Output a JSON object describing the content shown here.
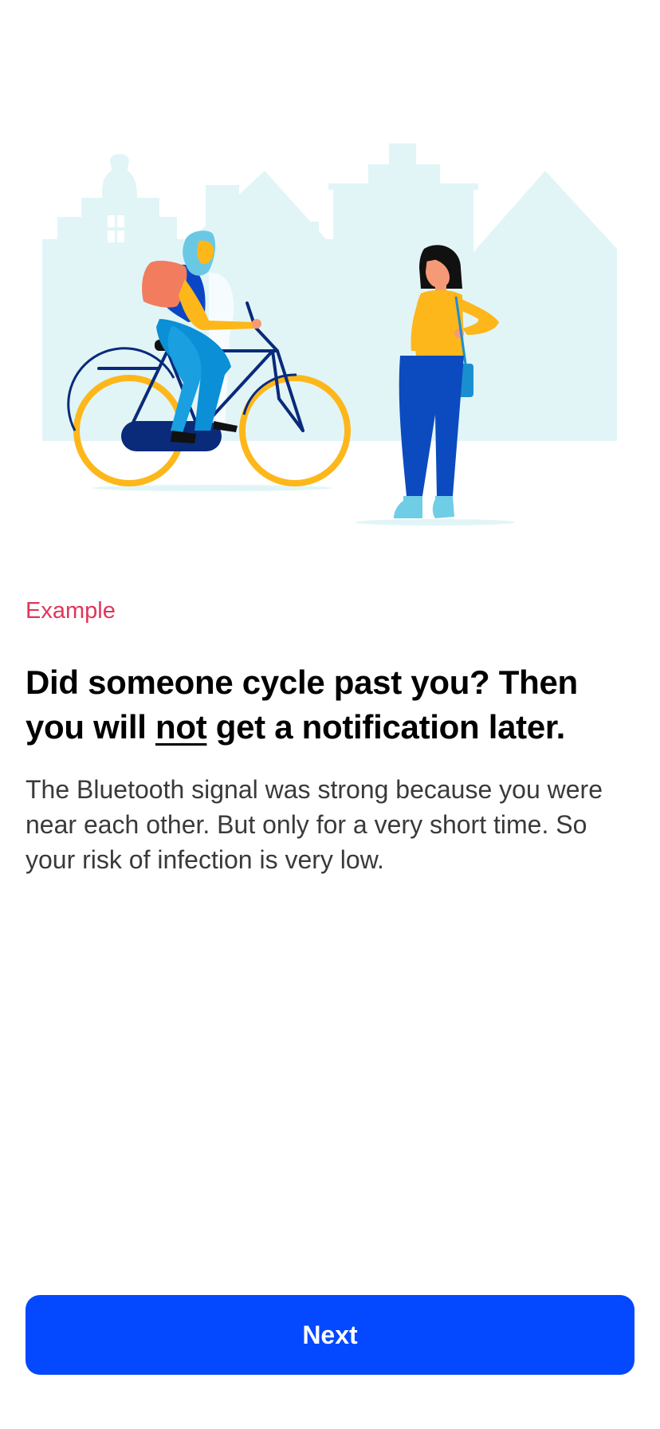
{
  "illustration": {
    "description_icon": "cyclist-passing-pedestrian-illustration",
    "colors": {
      "buildings": "#e1f5f7",
      "wheel": "#fdb71a",
      "frame": "#0a2a7a",
      "pants_blue": "#0b5bd3",
      "shirt_yellow": "#fdb71a",
      "backpack": "#f27c5e",
      "skin": "#f59a76",
      "hair_black": "#111111",
      "headscarf": "#6ac8e4",
      "bag": "#1a8fd0",
      "shoes": "#6fcde6"
    }
  },
  "eyebrow": {
    "label": "Example",
    "color": "#e0365a"
  },
  "headline": {
    "part1": "Did someone cycle past you? Then you will ",
    "emphasis": "not",
    "part2": " get a notification later."
  },
  "body": {
    "text": "The Bluetooth signal was strong because you were near each other. But only for a very short time. So your risk of infection is very low."
  },
  "next_button": {
    "label": "Next",
    "color": "#0448ff"
  }
}
